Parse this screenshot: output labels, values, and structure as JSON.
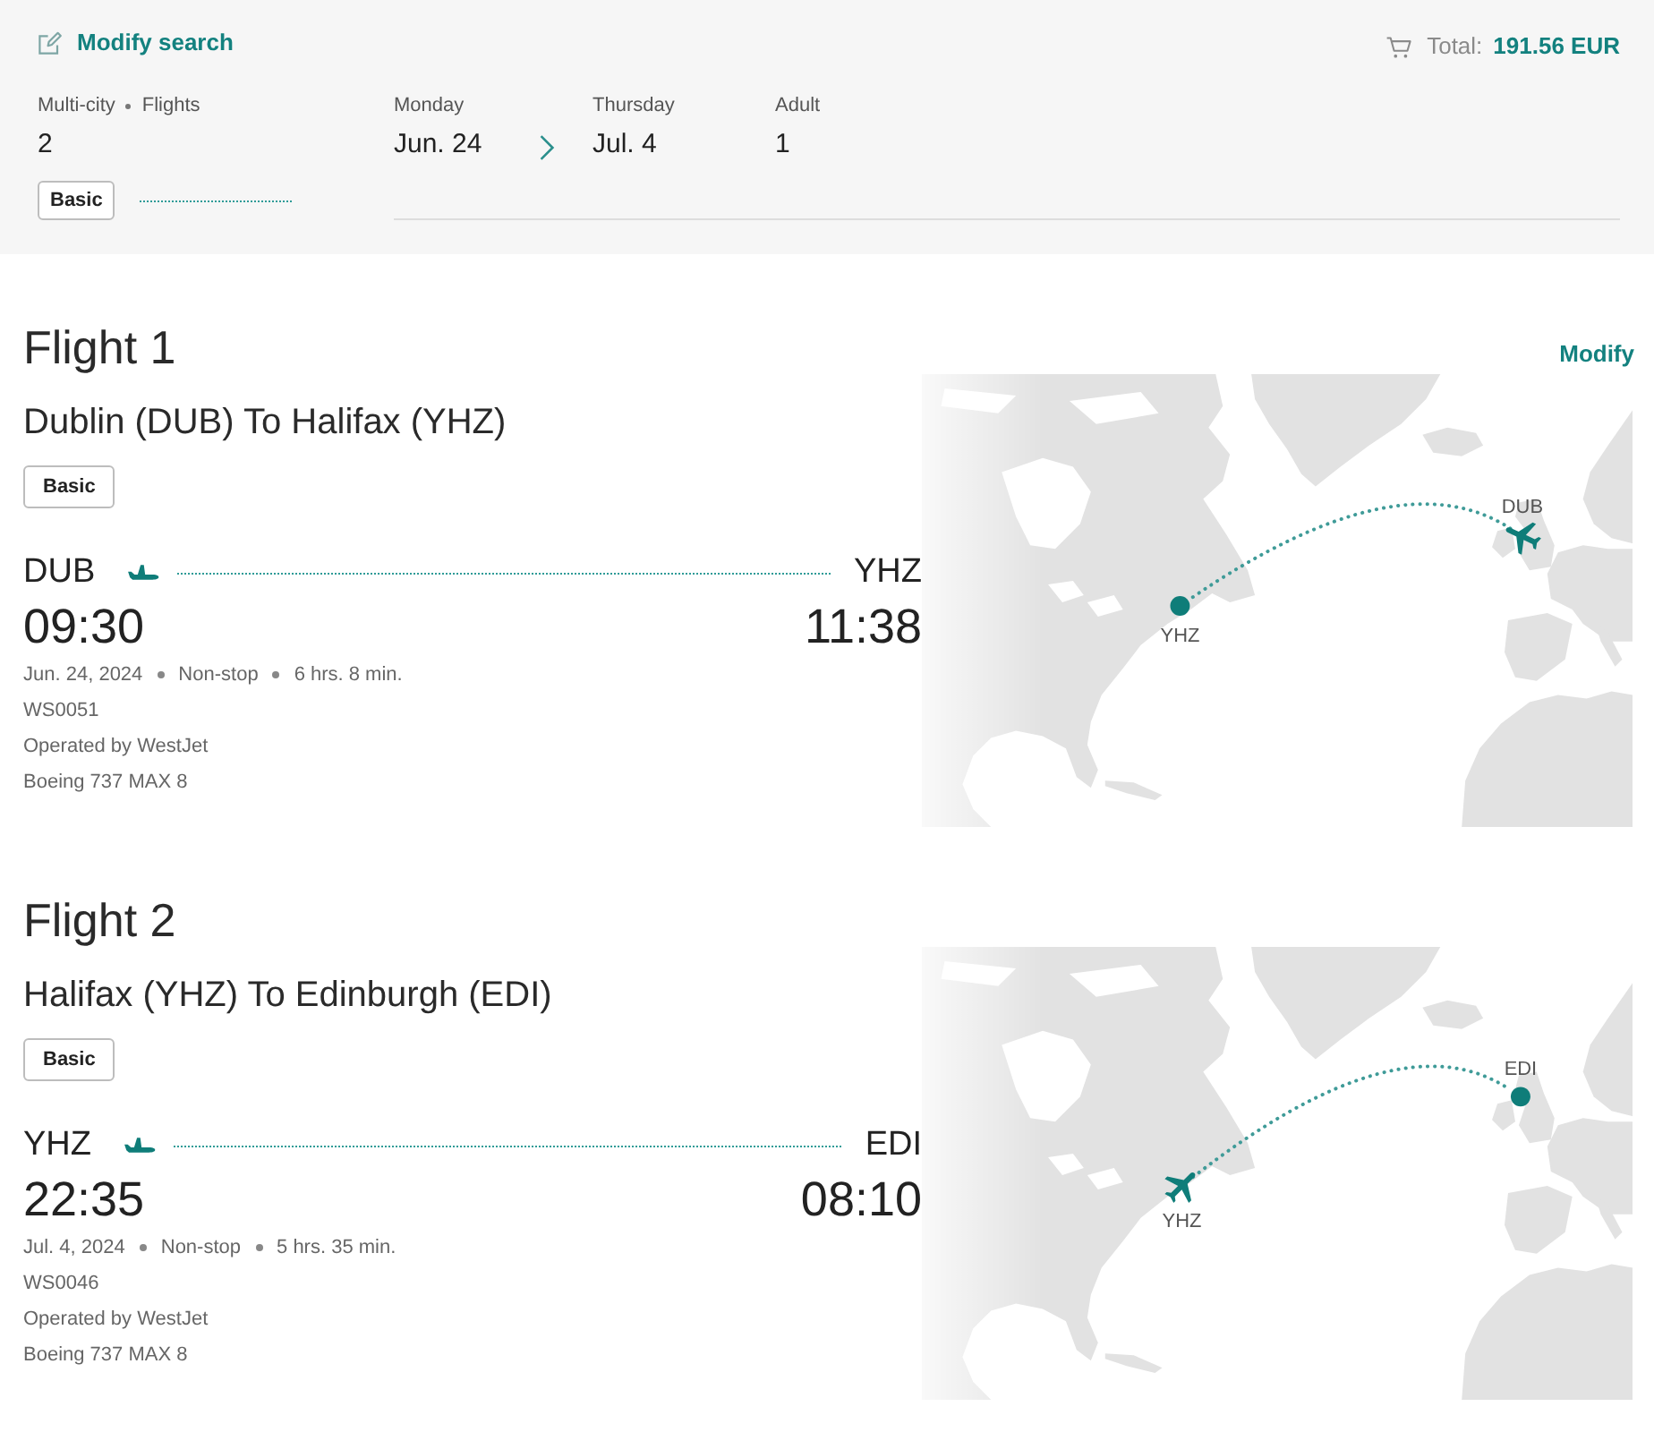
{
  "header": {
    "modify_search": "Modify search",
    "total_label": "Total:",
    "total_amount": "191.56 EUR",
    "trip": {
      "type": "Multi-city",
      "segments_label": "Flights",
      "segments_count": "2",
      "fare": "Basic"
    },
    "dates": [
      {
        "weekday": "Monday",
        "date": "Jun. 24"
      },
      {
        "weekday": "Thursday",
        "date": "Jul. 4"
      }
    ],
    "passengers": {
      "label": "Adult",
      "count": "1"
    }
  },
  "flights": [
    {
      "title": "Flight 1",
      "modify": "Modify",
      "route": "Dublin (DUB) To Halifax (YHZ)",
      "fare": "Basic",
      "origin": {
        "code": "DUB",
        "time": "09:30"
      },
      "destination": {
        "code": "YHZ",
        "time": "11:38"
      },
      "date": "Jun. 24, 2024",
      "stops": "Non-stop",
      "duration": "6 hrs. 8 min.",
      "flight_number": "WS0051",
      "operator": "Operated by WestJet",
      "aircraft": "Boeing 737 MAX 8",
      "map": {
        "markers": [
          {
            "label": "DUB",
            "kind": "plane"
          },
          {
            "label": "YHZ",
            "kind": "dot"
          }
        ]
      }
    },
    {
      "title": "Flight 2",
      "route": "Halifax (YHZ) To Edinburgh (EDI)",
      "fare": "Basic",
      "origin": {
        "code": "YHZ",
        "time": "22:35"
      },
      "destination": {
        "code": "EDI",
        "time": "08:10"
      },
      "date": "Jul. 4, 2024",
      "stops": "Non-stop",
      "duration": "5 hrs. 35 min.",
      "flight_number": "WS0046",
      "operator": "Operated by WestJet",
      "aircraft": "Boeing 737 MAX 8",
      "map": {
        "markers": [
          {
            "label": "YHZ",
            "kind": "plane"
          },
          {
            "label": "EDI",
            "kind": "dot"
          }
        ]
      }
    }
  ]
}
